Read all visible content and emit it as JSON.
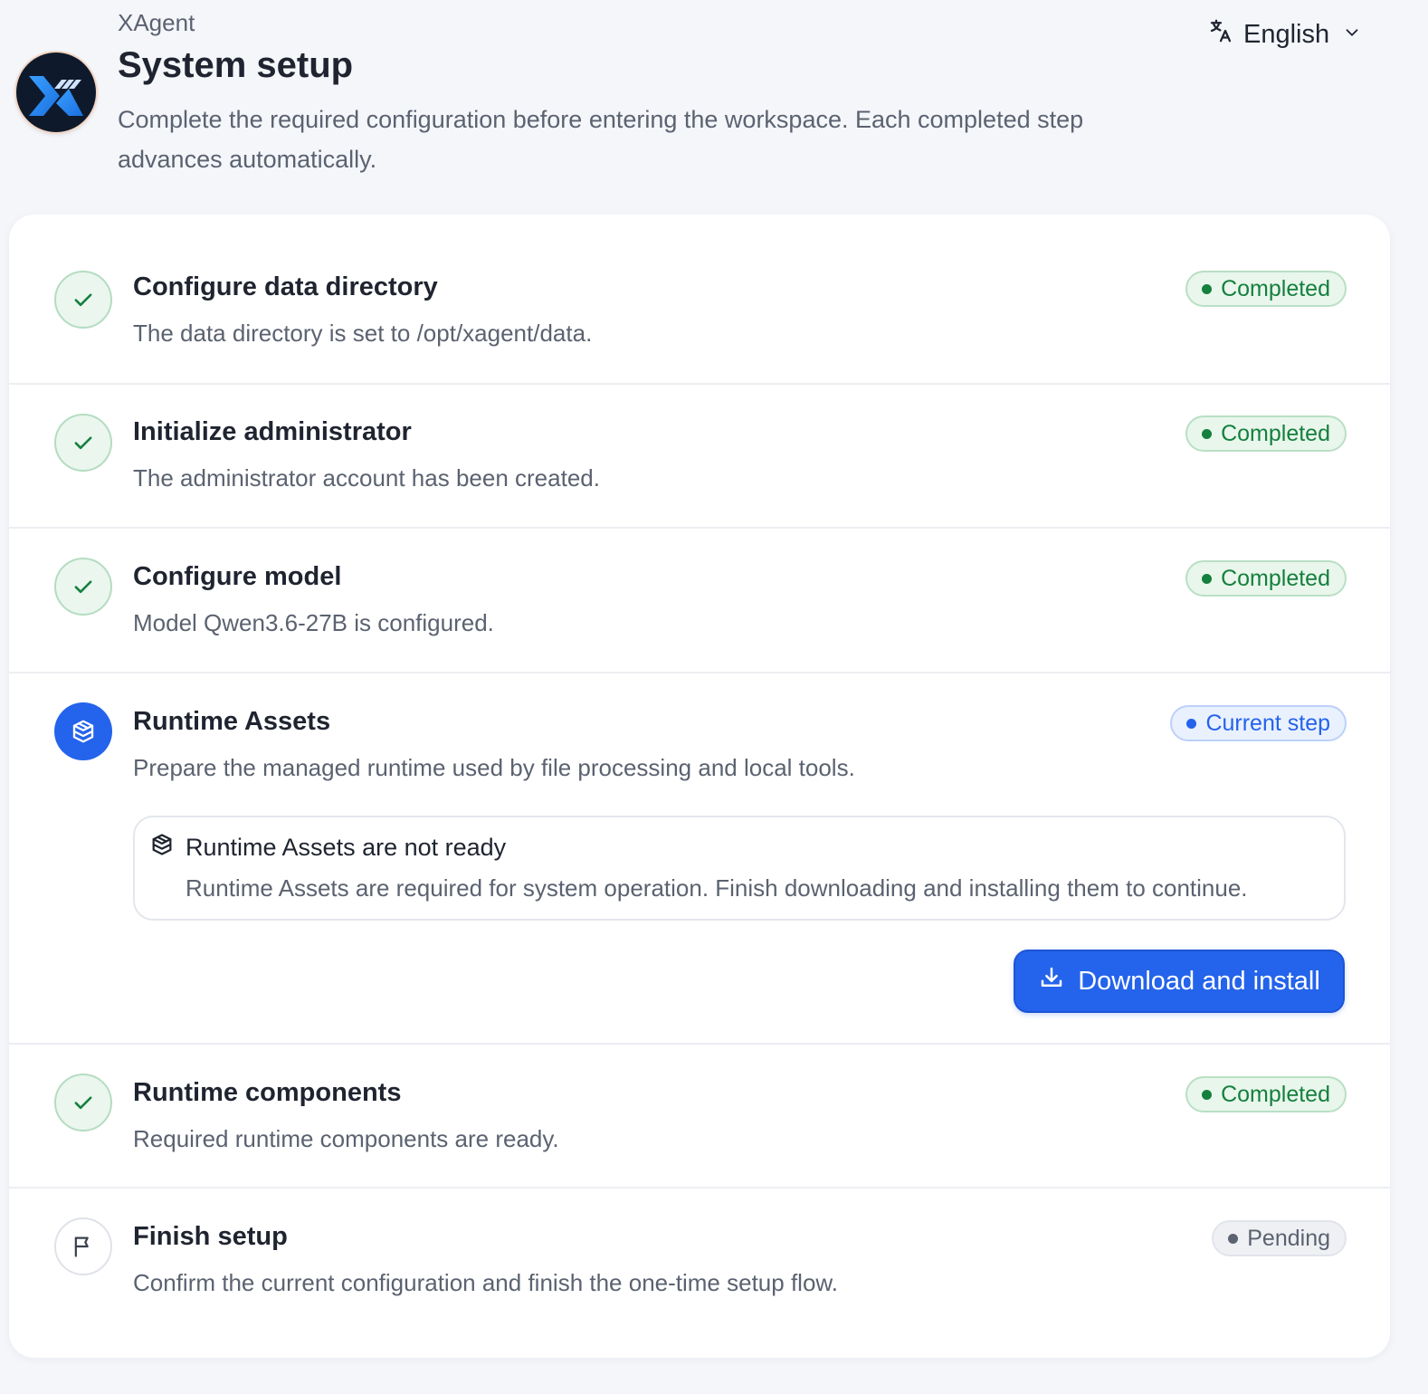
{
  "header": {
    "app_name": "XAgent",
    "title": "System setup",
    "description": "Complete the required configuration before entering the workspace. Each completed step advances automatically."
  },
  "language": {
    "selected": "English",
    "icon": "translate-icon"
  },
  "colors": {
    "accent": "#2463eb",
    "success": "#15803d",
    "pending": "#5b6270"
  },
  "steps": [
    {
      "title": "Configure data directory",
      "description": "The data directory is set to /opt/xagent/data.",
      "status": "Completed"
    },
    {
      "title": "Initialize administrator",
      "description": "The administrator account has been created.",
      "status": "Completed"
    },
    {
      "title": "Configure model",
      "description": "Model Qwen3.6-27B is configured.",
      "status": "Completed"
    },
    {
      "title": "Runtime Assets",
      "description": "Prepare the managed runtime used by file processing and local tools.",
      "status": "Current step",
      "notice": {
        "title": "Runtime Assets are not ready",
        "description": "Runtime Assets are required for system operation. Finish downloading and installing them to continue."
      },
      "action_label": "Download and install"
    },
    {
      "title": "Runtime components",
      "description": "Required runtime components are ready.",
      "status": "Completed"
    },
    {
      "title": "Finish setup",
      "description": "Confirm the current configuration and finish the one-time setup flow.",
      "status": "Pending"
    }
  ]
}
